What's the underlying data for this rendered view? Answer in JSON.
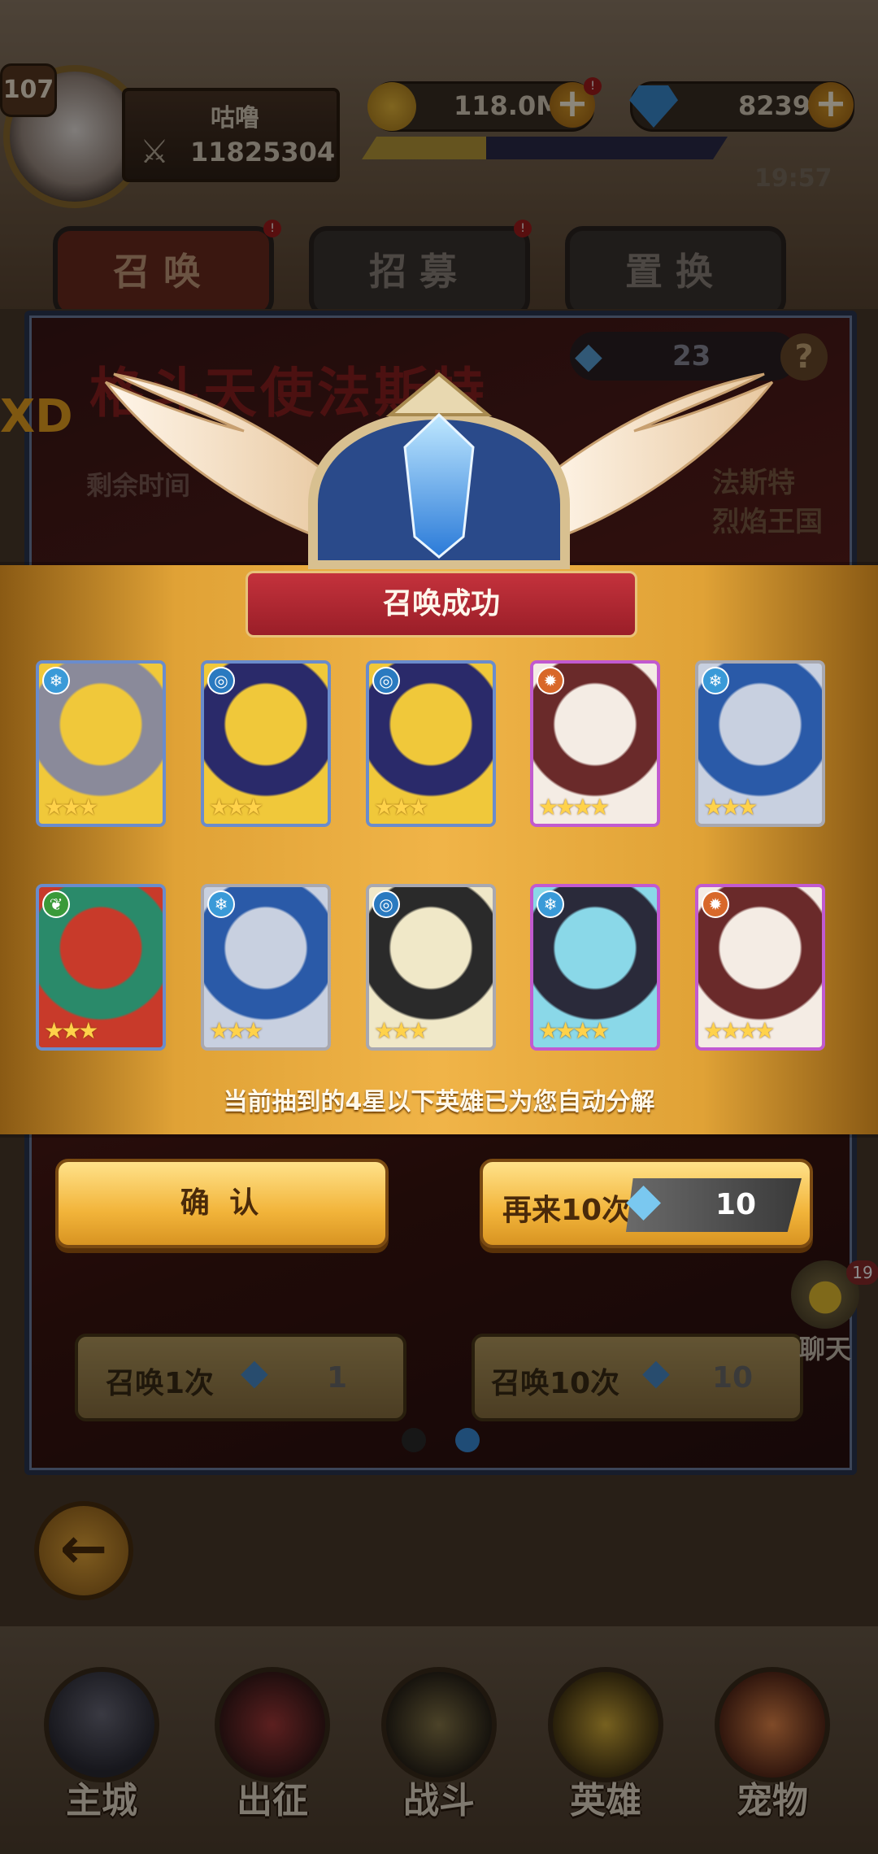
{
  "player": {
    "level": "107",
    "name": "咕噜",
    "power": "11825304"
  },
  "currencies": {
    "gold": "118.0M",
    "gems": "8239"
  },
  "clock": "19:57",
  "tabs": [
    {
      "label": "召唤",
      "active": true
    },
    {
      "label": "招募",
      "active": false
    },
    {
      "label": "置换",
      "active": false
    }
  ],
  "banner": {
    "title": "格斗天使法斯特",
    "remaining_prefix": "剩余时间",
    "hero_name_fragment": "法斯特",
    "kingdom_fragment": "烈焰王国",
    "ticket_count": "23",
    "help": "?",
    "side_letters": "XD"
  },
  "result": {
    "title": "召唤成功",
    "info": "当前抽到的4星以下英雄已为您自动分解",
    "heroes": [
      {
        "element": "ice",
        "stars": 3,
        "frame": "blue",
        "icon": "viking-hero"
      },
      {
        "element": "water",
        "stars": 3,
        "frame": "blue",
        "icon": "blonde-eyepatch-hero"
      },
      {
        "element": "water",
        "stars": 3,
        "frame": "blue",
        "icon": "blonde-eyepatch-hero"
      },
      {
        "element": "fire",
        "stars": 4,
        "frame": "purple",
        "icon": "white-hair-hat-hero"
      },
      {
        "element": "ice",
        "stars": 3,
        "frame": "silver",
        "icon": "blue-knight-hero"
      },
      {
        "element": "wood",
        "stars": 3,
        "frame": "blue",
        "icon": "archer-hero"
      },
      {
        "element": "ice",
        "stars": 3,
        "frame": "silver",
        "icon": "blue-knight-hero"
      },
      {
        "element": "water",
        "stars": 3,
        "frame": "silver",
        "icon": "goggles-hero"
      },
      {
        "element": "ice",
        "stars": 4,
        "frame": "purple",
        "icon": "cyan-goggles-hero"
      },
      {
        "element": "fire",
        "stars": 4,
        "frame": "purple",
        "icon": "white-hair-hat-hero"
      }
    ],
    "confirm_label": "确 认",
    "again_label": "再来10次",
    "again_cost": "10"
  },
  "summon_buttons": [
    {
      "label": "召唤1次",
      "cost": "1"
    },
    {
      "label": "召唤10次",
      "cost": "10"
    }
  ],
  "chat": {
    "label": "聊天",
    "badge": "19"
  },
  "nav": [
    {
      "label": "主城",
      "icon": "castle-icon"
    },
    {
      "label": "出征",
      "icon": "expedition-icon"
    },
    {
      "label": "战斗",
      "icon": "battle-icon"
    },
    {
      "label": "英雄",
      "icon": "hero-icon"
    },
    {
      "label": "宠物",
      "icon": "pet-icon"
    }
  ],
  "colors": {
    "fire": "#d8682a",
    "ice": "#3a9ad8",
    "water": "#2a7ac0",
    "wood": "#3a9a3a"
  }
}
